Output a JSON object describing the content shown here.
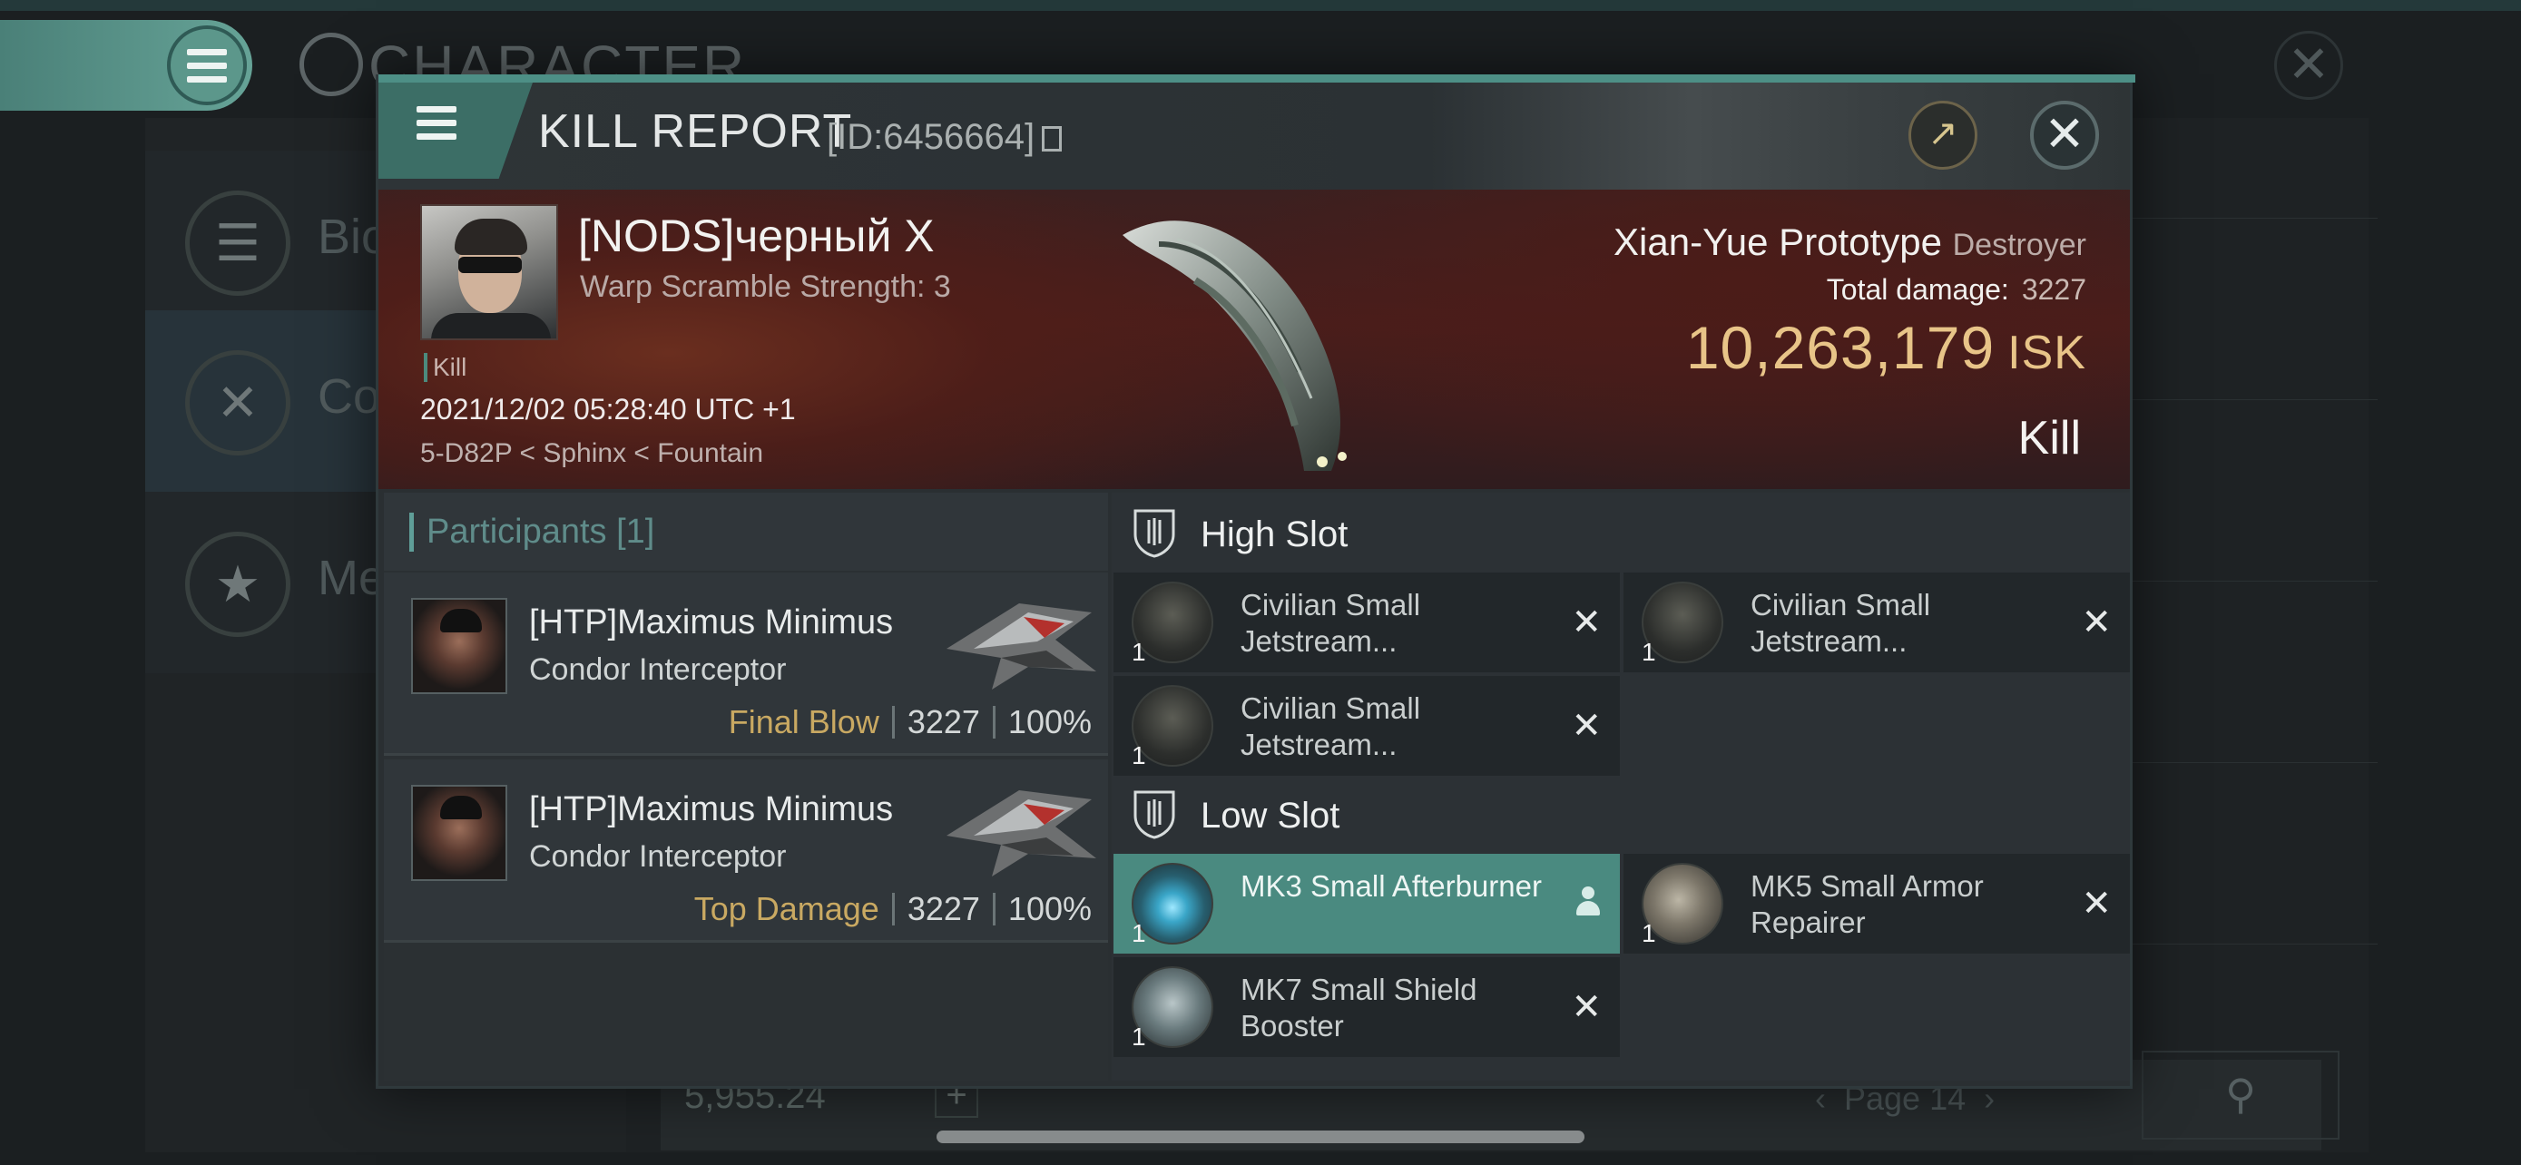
{
  "background": {
    "title": "CHARACTER",
    "side_items": [
      {
        "label": "Bio",
        "icon": "list-icon"
      },
      {
        "label": "Co",
        "icon": "crossed-swords-icon"
      },
      {
        "label": "Me",
        "icon": "star-badge-icon"
      }
    ],
    "wallet_value": "5,955.24",
    "page_label": "Page 14"
  },
  "dialog": {
    "title": "KILL REPORT",
    "id_text": "[ID:6456664]"
  },
  "victim": {
    "name": "[NODS]черный X",
    "sub": "Warp Scramble Strength: 3",
    "tag": "Kill",
    "datetime": "2021/12/02 05:28:40 UTC +1",
    "location": "5-D82P < Sphinx < Fountain",
    "ship_name": "Xian-Yue Prototype",
    "ship_class": "Destroyer",
    "total_damage_label": "Total damage:",
    "total_damage": "3227",
    "isk_value": "10,263,179",
    "isk_unit": "ISK",
    "result": "Kill"
  },
  "participants": {
    "title": "Participants [1]",
    "items": [
      {
        "name": "[HTP]Maximus Minimus",
        "ship": "Condor Interceptor",
        "role": "Final Blow",
        "damage": "3227",
        "percent": "100%"
      },
      {
        "name": "[HTP]Maximus Minimus",
        "ship": "Condor Interceptor",
        "role": "Top Damage",
        "damage": "3227",
        "percent": "100%"
      }
    ]
  },
  "fitting": {
    "high_slot": {
      "title": "High Slot",
      "modules": [
        {
          "name": "Civilian Small Jetstream...",
          "qty": "1"
        },
        {
          "name": "Civilian Small Jetstream...",
          "qty": "1"
        },
        {
          "name": "Civilian Small Jetstream...",
          "qty": "1"
        }
      ]
    },
    "low_slot": {
      "title": "Low Slot",
      "modules": [
        {
          "name": "MK3 Small Afterburner",
          "qty": "1"
        },
        {
          "name": "MK5 Small Armor Repairer",
          "qty": "1"
        },
        {
          "name": "MK7 Small Shield Booster",
          "qty": "1"
        }
      ]
    }
  },
  "colors": {
    "accent": "#4a8a80",
    "isk": "#e8c488",
    "final_blow": "#c9a962"
  }
}
